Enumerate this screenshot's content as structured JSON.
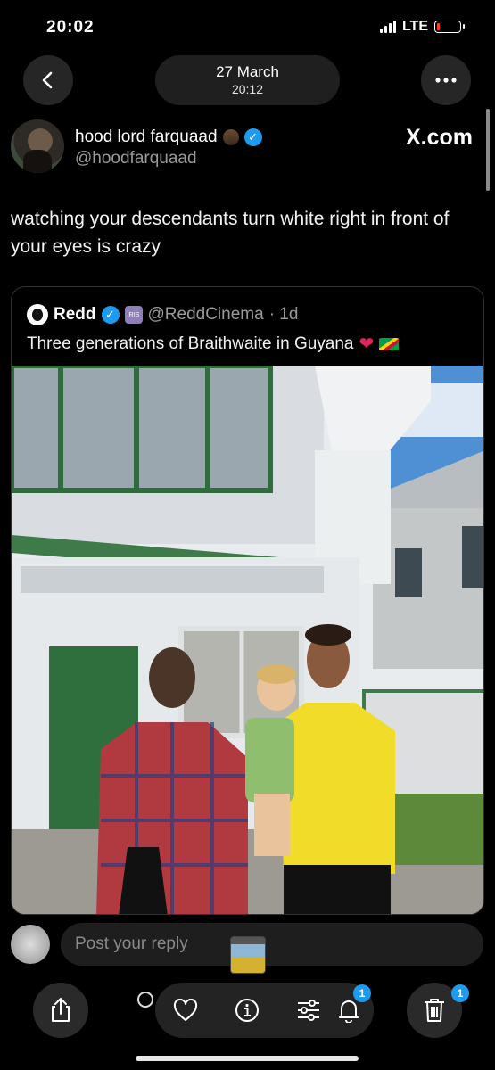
{
  "status_bar": {
    "time": "20:02",
    "network": "LTE"
  },
  "nav": {
    "date": "27 March",
    "time": "20:12"
  },
  "tweet": {
    "author_name": "hood lord farquaad",
    "author_handle": "@hoodfarquaad",
    "source": "X.com",
    "text": "watching your descendants turn white right in front of your eyes is crazy"
  },
  "quoted": {
    "name": "Redd",
    "badge_text": "IRIS",
    "handle": "@ReddCinema",
    "age": "· 1d",
    "text": "Three generations of Braithwaite in Guyana"
  },
  "reply": {
    "placeholder": "Post your reply"
  },
  "badges": {
    "notifications": "1",
    "trash": "1"
  },
  "colors": {
    "accent": "#1d9bf0",
    "background": "#000000",
    "pill": "#232323"
  }
}
